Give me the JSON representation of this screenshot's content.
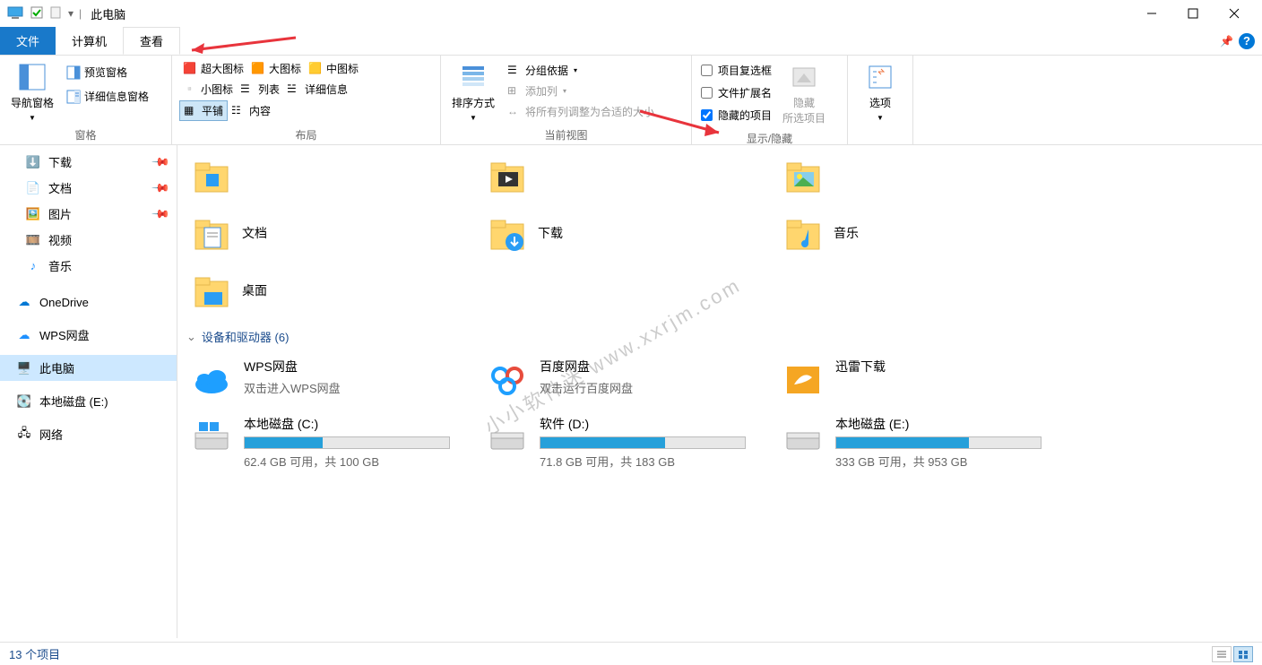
{
  "titlebar": {
    "title": "此电脑"
  },
  "tabs": {
    "file": "文件",
    "computer": "计算机",
    "view": "查看"
  },
  "ribbon": {
    "group_panes": {
      "label": "窗格",
      "nav": "导航窗格",
      "preview": "预览窗格",
      "details": "详细信息窗格"
    },
    "group_layout": {
      "label": "布局",
      "extralarge": "超大图标",
      "large": "大图标",
      "medium": "中图标",
      "small": "小图标",
      "list": "列表",
      "details": "详细信息",
      "tiles": "平铺",
      "content": "内容"
    },
    "group_view": {
      "label": "当前视图",
      "sort": "排序方式",
      "group": "分组依据",
      "addcol": "添加列",
      "sizecols": "将所有列调整为合适的大小"
    },
    "group_showhide": {
      "label": "显示/隐藏",
      "itemcheck": "项目复选框",
      "fileext": "文件扩展名",
      "hiddenitems": "隐藏的项目",
      "hide_btn": "隐藏",
      "hide_sub": "所选项目"
    },
    "group_options": {
      "options": "选项"
    }
  },
  "sidebar": {
    "downloads": "下载",
    "documents": "文档",
    "pictures": "图片",
    "videos": "视频",
    "music": "音乐",
    "onedrive": "OneDrive",
    "wpsdisk": "WPS网盘",
    "thispc": "此电脑",
    "localE": "本地磁盘 (E:)",
    "network": "网络"
  },
  "main": {
    "folders": {
      "documents": "文档",
      "downloads": "下载",
      "music": "音乐",
      "desktop": "桌面"
    },
    "group_devices": "设备和驱动器 (6)",
    "wps": {
      "name": "WPS网盘",
      "sub": "双击进入WPS网盘"
    },
    "baidu": {
      "name": "百度网盘",
      "sub": "双击运行百度网盘"
    },
    "xunlei": {
      "name": "迅雷下载"
    },
    "driveC": {
      "name": "本地磁盘 (C:)",
      "sub": "62.4 GB 可用，共 100 GB",
      "pct": 38
    },
    "driveD": {
      "name": "软件 (D:)",
      "sub": "71.8 GB 可用，共 183 GB",
      "pct": 61
    },
    "driveE": {
      "name": "本地磁盘 (E:)",
      "sub": "333 GB 可用，共 953 GB",
      "pct": 65
    }
  },
  "statusbar": {
    "count": "13 个项目"
  },
  "watermark": "小小软件迷 www.xxrjm.com"
}
